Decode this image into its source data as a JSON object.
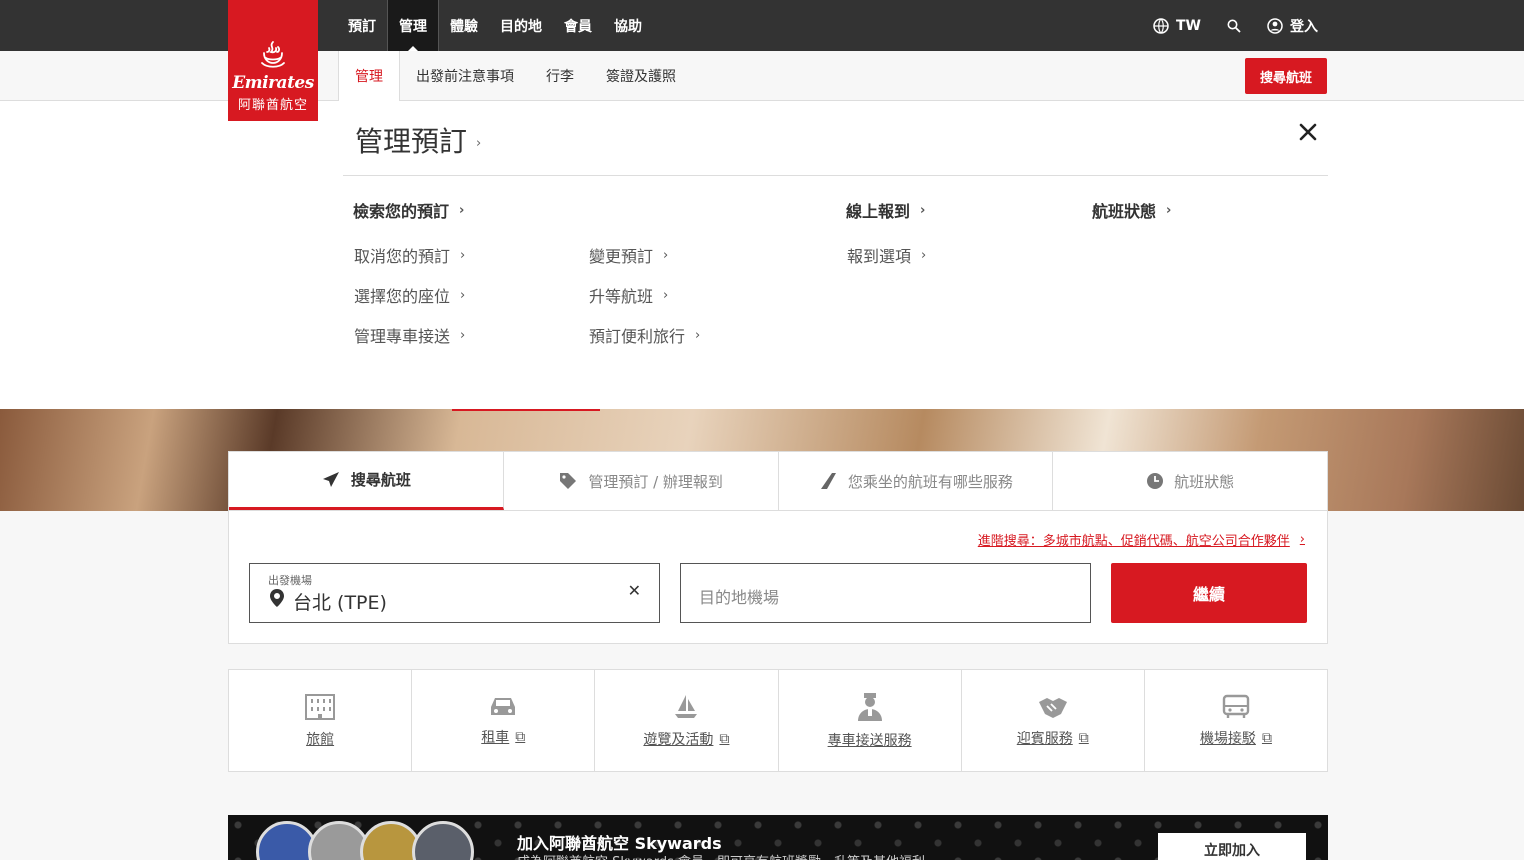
{
  "brand": {
    "name_en": "Emirates",
    "name_zh": "阿聯酋航空",
    "accent_color": "#d71921"
  },
  "top_nav": {
    "items": [
      "預訂",
      "管理",
      "體驗",
      "目的地",
      "會員",
      "協助"
    ],
    "active": "管理",
    "region": "TW",
    "login_label": "登入"
  },
  "sub_nav": {
    "items": [
      "管理",
      "出發前注意事項",
      "行李",
      "簽證及護照"
    ],
    "active": "管理",
    "search_button": "搜尋航班"
  },
  "dropdown": {
    "title": "管理預訂",
    "col1_head": "檢索您的預訂",
    "col1_links": [
      "取消您的預訂",
      "選擇您的座位",
      "管理專車接送"
    ],
    "col2_links": [
      "變更預訂",
      "升等航班",
      "預訂便利旅行"
    ],
    "col3_head": "線上報到",
    "col3_links": [
      "報到選項"
    ],
    "col4_head": "航班狀態"
  },
  "booking": {
    "tabs": [
      "搜尋航班",
      "管理預訂 / 辦理報到",
      "您乘坐的航班有哪些服務",
      "航班狀態"
    ],
    "active_tab": "搜尋航班",
    "advanced_link": "進階搜尋：多城市航點、促銷代碼、航空公司合作夥伴",
    "from_label": "出發機場",
    "from_value": "台北 (TPE)",
    "to_placeholder": "目的地機場",
    "continue_label": "繼續"
  },
  "services": [
    {
      "label": "旅館",
      "icon": "hotel-icon",
      "external": false
    },
    {
      "label": "租車",
      "icon": "car-icon",
      "external": true
    },
    {
      "label": "遊覽及活動",
      "icon": "sailboat-icon",
      "external": true
    },
    {
      "label": "專車接送服務",
      "icon": "chauffeur-icon",
      "external": false
    },
    {
      "label": "迎賓服務",
      "icon": "handshake-icon",
      "external": true
    },
    {
      "label": "機場接駁",
      "icon": "bus-icon",
      "external": true
    }
  ],
  "skywards": {
    "title": "加入阿聯酋航空 Skywards",
    "subtitle": "成為阿聯酋航空 Skywards 會員，即可享有航班獎勵、升等及其他福利",
    "join_label": "立即加入"
  }
}
